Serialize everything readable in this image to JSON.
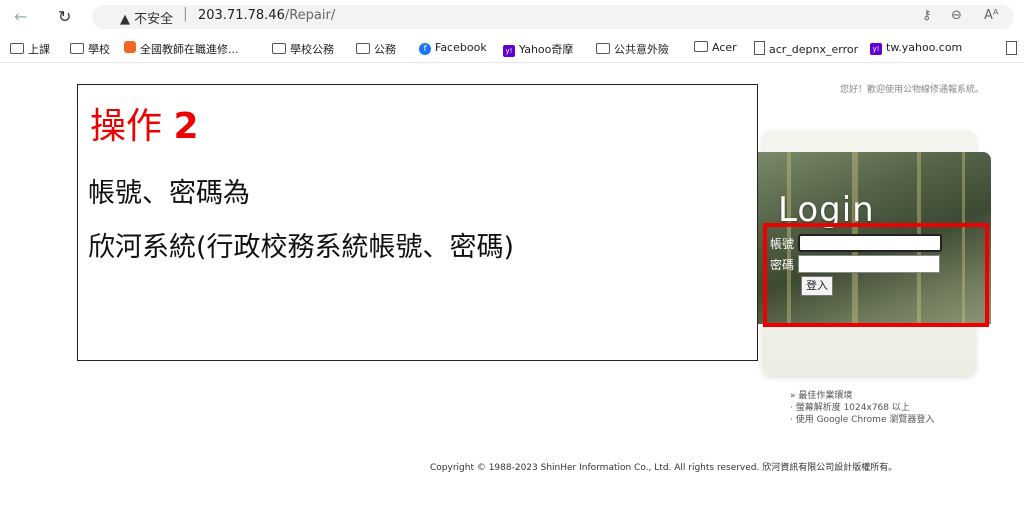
{
  "browser": {
    "warning": "不安全",
    "url_host": "203.71.78.46",
    "url_path": "/Repair/"
  },
  "bookmarks": [
    {
      "label": "上課",
      "icon": "folder-icon"
    },
    {
      "label": "學校",
      "icon": "folder-icon"
    },
    {
      "label": "全國教師在職進修...",
      "icon": "site-icon"
    },
    {
      "label": "學校公務",
      "icon": "folder-icon"
    },
    {
      "label": "公務",
      "icon": "folder-icon"
    },
    {
      "label": "Facebook",
      "icon": "facebook-icon"
    },
    {
      "label": "Yahoo奇摩",
      "icon": "yahoo-icon"
    },
    {
      "label": "公共意外險",
      "icon": "folder-icon"
    },
    {
      "label": "Acer",
      "icon": "folder-icon"
    },
    {
      "label": "acr_depnx_error",
      "icon": "page-icon"
    },
    {
      "label": "tw.yahoo.com",
      "icon": "yahoo-icon"
    }
  ],
  "greeting": "您好！歡迎使用公物線修通報系統。",
  "callout": {
    "title_prefix": "操作",
    "title_num": "2",
    "line1": "帳號、密碼為",
    "line2": "欣河系統(行政校務系統帳號、密碼)"
  },
  "login": {
    "heading": "Login",
    "account_label": "帳號",
    "password_label": "密碼",
    "submit_label": "登入"
  },
  "tips": {
    "title": "» 最佳作業環境",
    "line1": "· 螢幕解析度 1024x768 以上",
    "line2": "· 使用 Google Chrome 瀏覽器登入"
  },
  "footer": "Copyright © 1988-2023 ShinHer Information Co., Ltd. All rights reserved.   欣河資訊有限公司設計版權所有。",
  "colors": {
    "accent_red": "#e00000"
  }
}
